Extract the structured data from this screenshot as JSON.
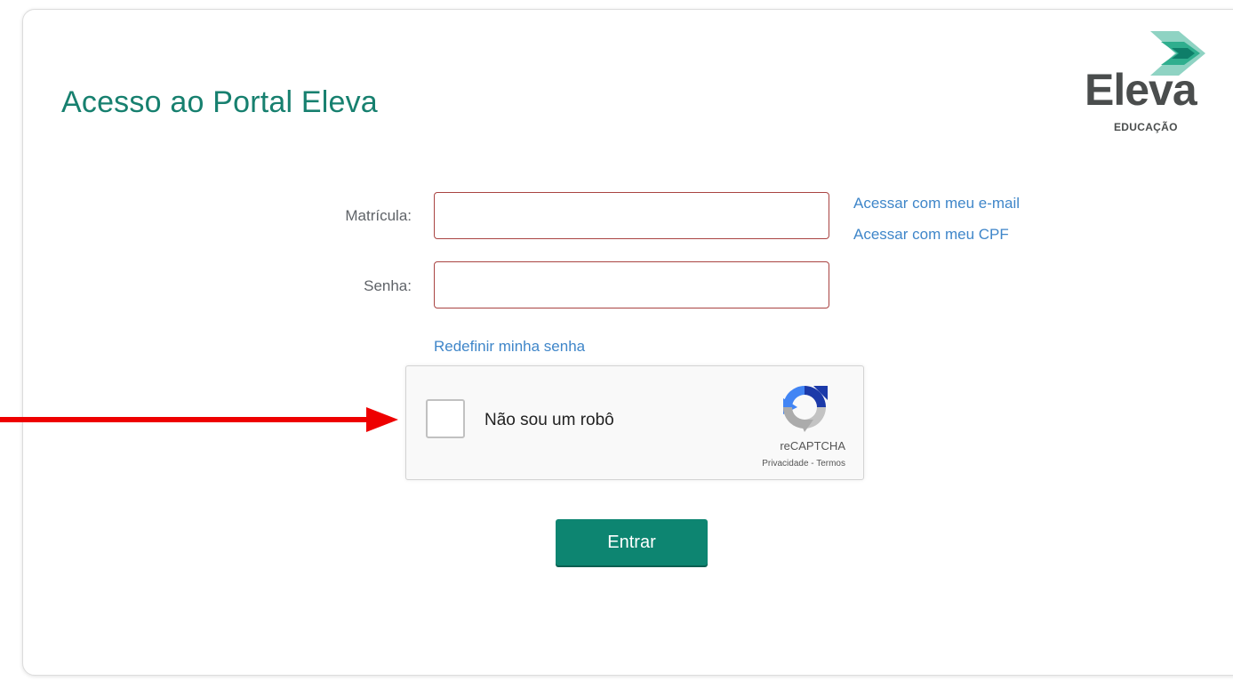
{
  "header": {
    "title": "Acesso ao Portal Eleva",
    "logo_word": "Eleva",
    "logo_sub": "EDUCAÇÃO"
  },
  "form": {
    "matricula_label": "Matrícula:",
    "matricula_value": "",
    "senha_label": "Senha:",
    "senha_value": "",
    "link_email": "Acessar com meu e-mail",
    "link_cpf": "Acessar com meu CPF",
    "link_reset": "Redefinir minha senha",
    "submit_label": "Entrar"
  },
  "recaptcha": {
    "label": "Não sou um robô",
    "brand": "reCAPTCHA",
    "terms": "Privacidade - Termos",
    "checked": false
  },
  "colors": {
    "title": "#17806f",
    "link": "#3f86c9",
    "input_border": "#a94442",
    "button": "#0d8571",
    "annotation_arrow": "#ee0000"
  }
}
